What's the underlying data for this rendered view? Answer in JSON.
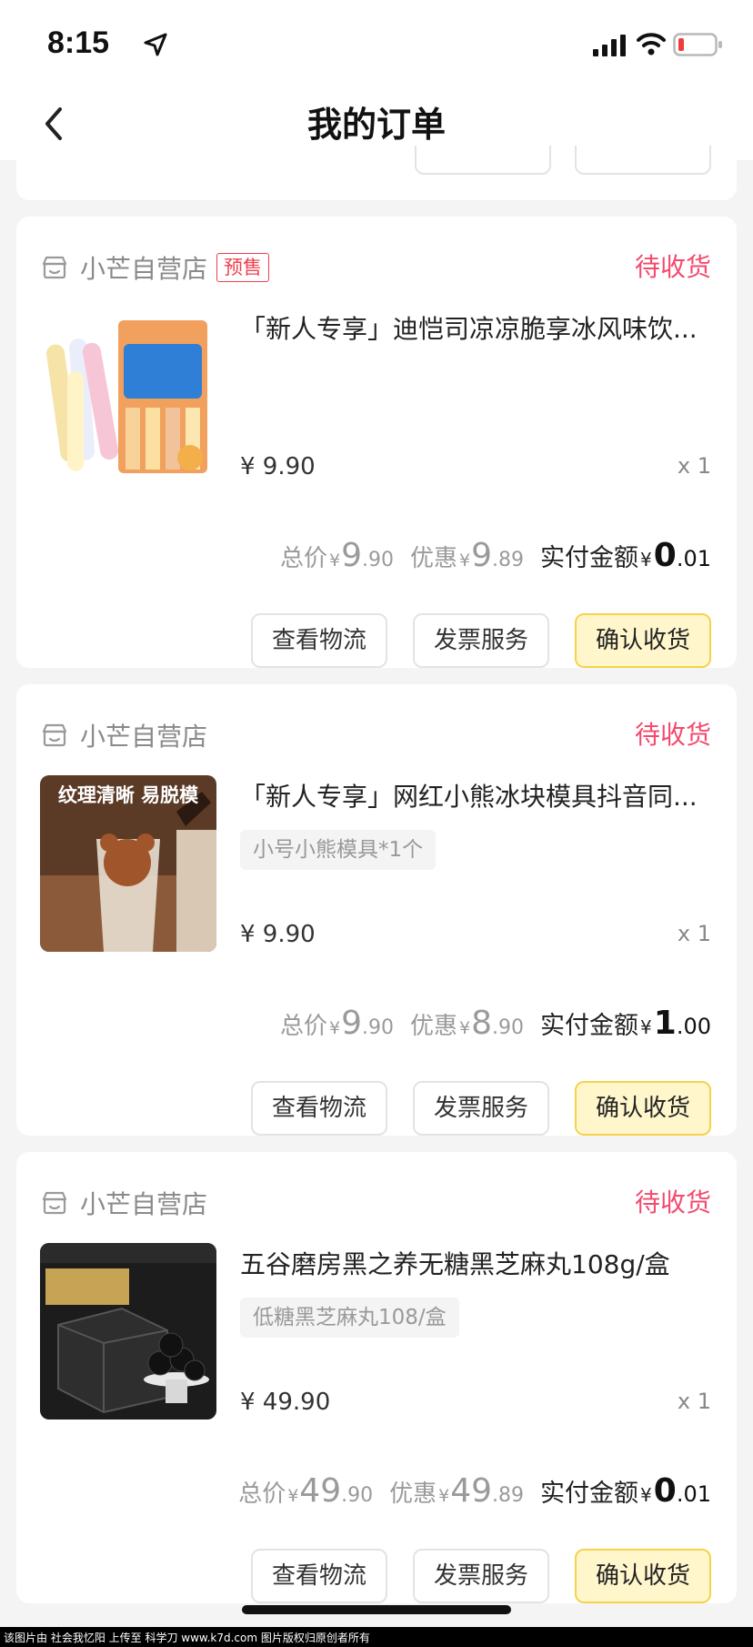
{
  "status_bar": {
    "time": "8:15"
  },
  "header": {
    "title": "我的订单"
  },
  "orders": [
    {
      "store_name": "小芒自营店",
      "tag": "预售",
      "status": "待收货",
      "product_title": "「新人专享」迪恺司凉凉脆享冰风味饮...",
      "sku": "",
      "unit_price": "¥ 9.90",
      "qty": "x 1",
      "total_label": "总价",
      "total_currency": "¥",
      "total_int": "9",
      "total_dec": ".90",
      "discount_label": "优惠",
      "discount_currency": "¥",
      "discount_int": "9",
      "discount_dec": ".89",
      "paid_label": "实付金额",
      "paid_currency": "¥",
      "paid_int": "0",
      "paid_dec": ".01",
      "btn_logistics": "查看物流",
      "btn_invoice": "发票服务",
      "btn_confirm": "确认收货"
    },
    {
      "store_name": "小芒自营店",
      "tag": "",
      "status": "待收货",
      "product_title": "「新人专享」网红小熊冰块模具抖音同...",
      "sku": "小号小熊模具*1个",
      "image_caption": "纹理清晰 易脱模",
      "unit_price": "¥ 9.90",
      "qty": "x 1",
      "total_label": "总价",
      "total_currency": "¥",
      "total_int": "9",
      "total_dec": ".90",
      "discount_label": "优惠",
      "discount_currency": "¥",
      "discount_int": "8",
      "discount_dec": ".90",
      "paid_label": "实付金额",
      "paid_currency": "¥",
      "paid_int": "1",
      "paid_dec": ".00",
      "btn_logistics": "查看物流",
      "btn_invoice": "发票服务",
      "btn_confirm": "确认收货"
    },
    {
      "store_name": "小芒自营店",
      "tag": "",
      "status": "待收货",
      "product_title": "五谷磨房黑之养无糖黑芝麻丸108g/盒",
      "sku": "低糖黑芝麻丸108/盒",
      "unit_price": "¥ 49.90",
      "qty": "x 1",
      "total_label": "总价",
      "total_currency": "¥",
      "total_int": "49",
      "total_dec": ".90",
      "discount_label": "优惠",
      "discount_currency": "¥",
      "discount_int": "49",
      "discount_dec": ".89",
      "paid_label": "实付金额",
      "paid_currency": "¥",
      "paid_int": "0",
      "paid_dec": ".01",
      "btn_logistics": "查看物流",
      "btn_invoice": "发票服务",
      "btn_confirm": "确认收货"
    }
  ],
  "footer": {
    "text": "该图片由 社会我忆阳 上传至 科学刀 www.k7d.com 图片版权归原创者所有"
  },
  "colors": {
    "status_red": "#f34a6e",
    "confirm_bg": "#fff6cc",
    "confirm_border": "#f6d24a",
    "tag_red": "#ef3f4d"
  }
}
